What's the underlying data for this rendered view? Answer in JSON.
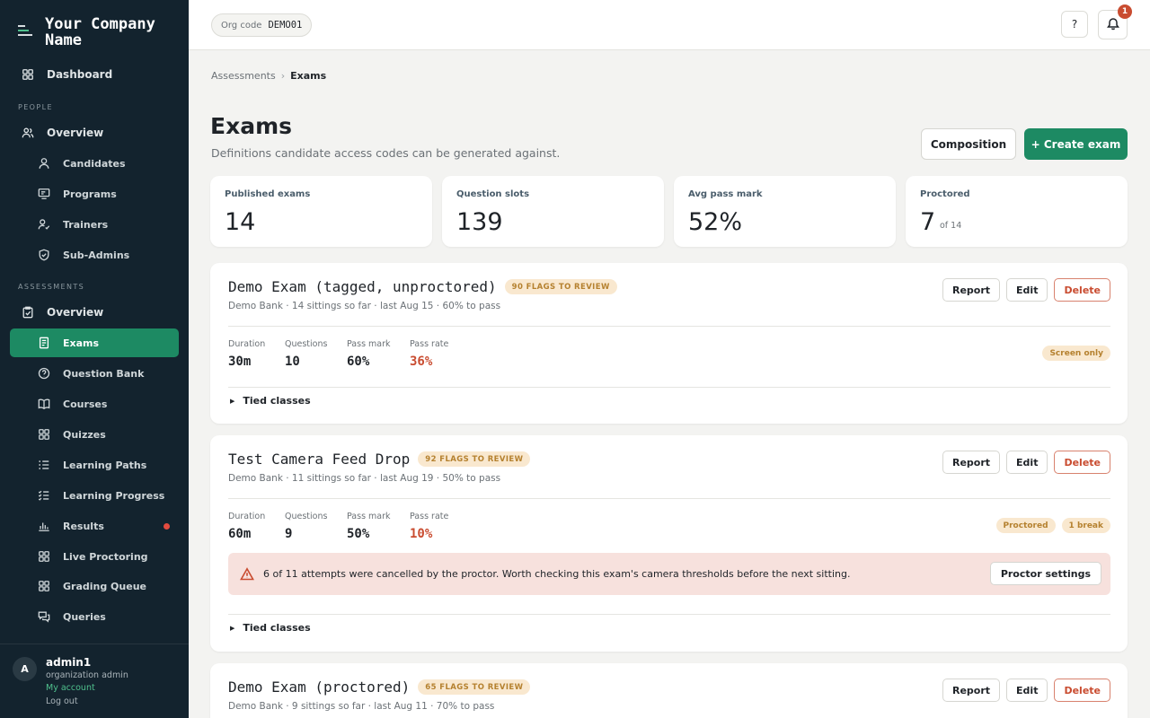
{
  "sidebar": {
    "brand": "Your Company Name",
    "dashboard": "Dashboard",
    "people_section": "PEOPLE",
    "people_overview": "Overview",
    "people_items": [
      "Candidates",
      "Programs",
      "Trainers",
      "Sub-Admins"
    ],
    "assessments_section": "ASSESSMENTS",
    "assessments_overview": "Overview",
    "assessment_items": [
      "Exams",
      "Question Bank",
      "Courses",
      "Quizzes",
      "Learning Paths",
      "Learning Progress",
      "Results",
      "Live Proctoring",
      "Grading Queue",
      "Queries"
    ],
    "active_item": "Exams"
  },
  "user": {
    "initial": "A",
    "name": "admin1",
    "role": "organization admin",
    "account_link": "My account",
    "logout": "Log out"
  },
  "topbar": {
    "org_label": "Org code",
    "org_code": "DEMO01",
    "help_label": "?",
    "notification_count": "1"
  },
  "breadcrumb": {
    "parent": "Assessments",
    "sep": "›",
    "current": "Exams"
  },
  "page": {
    "title": "Exams",
    "subtitle": "Definitions candidate access codes can be generated against.",
    "composition_label": "Composition",
    "create_label": "+ Create exam"
  },
  "stats": [
    {
      "label": "Published exams",
      "value": "14",
      "suffix": ""
    },
    {
      "label": "Question slots",
      "value": "139",
      "suffix": ""
    },
    {
      "label": "Avg pass mark",
      "value": "52%",
      "suffix": ""
    },
    {
      "label": "Proctored",
      "value": "7",
      "suffix": "of 14"
    }
  ],
  "actions": {
    "report": "Report",
    "edit": "Edit",
    "delete": "Delete"
  },
  "metric_labels": {
    "duration": "Duration",
    "questions": "Questions",
    "pass_mark": "Pass mark",
    "pass_rate": "Pass rate"
  },
  "tied_label": "Tied classes",
  "exams": [
    {
      "title": "Demo Exam (tagged, unproctored)",
      "flags": "90 FLAGS TO REVIEW",
      "meta": "Demo Bank · 14 sittings so far · last Aug 15 · 60% to pass",
      "duration": "30m",
      "questions": "10",
      "pass_mark": "60%",
      "pass_rate": "36%",
      "tags": [
        "Screen only"
      ]
    },
    {
      "title": "Test Camera Feed Drop",
      "flags": "92 FLAGS TO REVIEW",
      "meta": "Demo Bank · 11 sittings so far · last Aug 19 · 50% to pass",
      "duration": "60m",
      "questions": "9",
      "pass_mark": "50%",
      "pass_rate": "10%",
      "tags": [
        "Proctored",
        "1 break"
      ],
      "alert": "6 of 11 attempts were cancelled by the proctor. Worth checking this exam's camera thresholds before the next sitting.",
      "alert_action": "Proctor settings"
    },
    {
      "title": "Demo Exam (proctored)",
      "flags": "65 FLAGS TO REVIEW",
      "meta": "Demo Bank · 9 sittings so far · last Aug 11 · 70% to pass"
    }
  ]
}
